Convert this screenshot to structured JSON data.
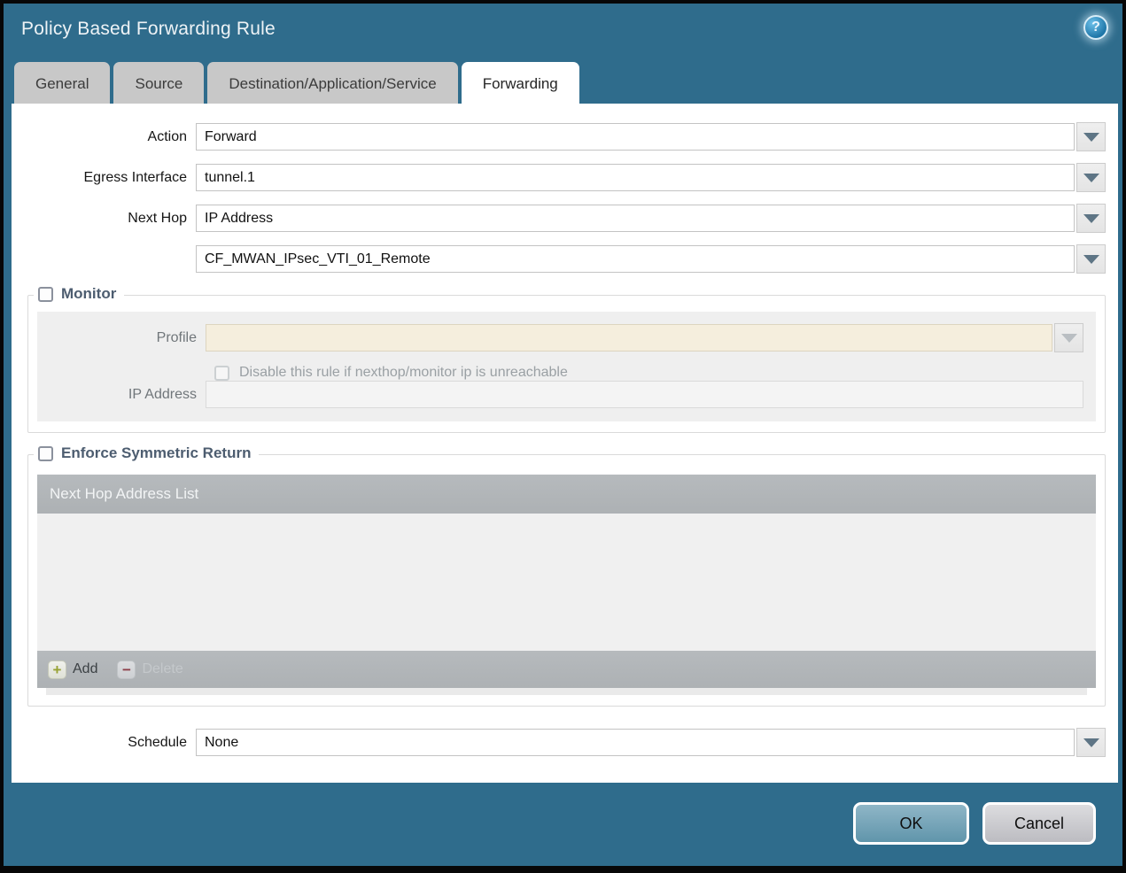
{
  "dialog": {
    "title": "Policy Based Forwarding Rule",
    "help_glyph": "?"
  },
  "tabs": [
    {
      "label": "General",
      "active": false
    },
    {
      "label": "Source",
      "active": false
    },
    {
      "label": "Destination/Application/Service",
      "active": false
    },
    {
      "label": "Forwarding",
      "active": true
    }
  ],
  "form": {
    "action": {
      "label": "Action",
      "value": "Forward"
    },
    "egress_interface": {
      "label": "Egress Interface",
      "value": "tunnel.1"
    },
    "next_hop": {
      "label": "Next Hop",
      "value": "IP Address"
    },
    "next_hop_address": {
      "value": "CF_MWAN_IPsec_VTI_01_Remote"
    },
    "schedule": {
      "label": "Schedule",
      "value": "None"
    }
  },
  "monitor": {
    "legend": "Monitor",
    "checked": false,
    "profile": {
      "label": "Profile",
      "value": ""
    },
    "disable_rule": {
      "label": "Disable this rule if nexthop/monitor ip is unreachable",
      "checked": false
    },
    "ip_address": {
      "label": "IP Address",
      "value": ""
    }
  },
  "enforce": {
    "legend": "Enforce Symmetric Return",
    "checked": false,
    "table": {
      "header": "Next Hop Address List",
      "rows": []
    },
    "add_label": "Add",
    "delete_label": "Delete"
  },
  "footer": {
    "ok_label": "OK",
    "cancel_label": "Cancel"
  },
  "colors": {
    "frame_teal": "#2f6c8c",
    "tab_inactive": "#c8c8c8",
    "disabled_field_tan": "#f5eedd",
    "table_gray": "#b1b5b8",
    "ok_button": "#6f9fb4"
  }
}
